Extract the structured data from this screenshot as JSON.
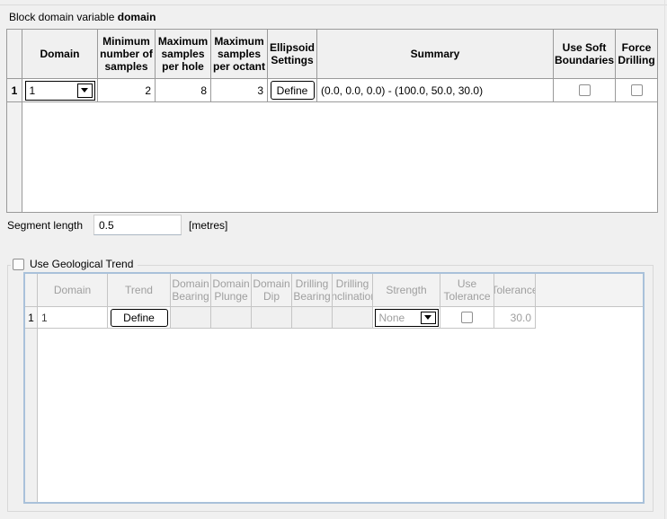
{
  "colors": {
    "panel_border": "#a9c1da",
    "grid_line_dark": "#9a9a9a",
    "grid_line_light": "#c5c5c5",
    "disabled_text": "#9e9e9e",
    "background": "#f0f0f0"
  },
  "header": {
    "title_prefix": "Block domain variable",
    "title_variable": "domain"
  },
  "domain_table": {
    "headers": {
      "domain": "Domain",
      "min_samples": "Minimum number of samples",
      "max_per_hole": "Maximum samples per hole",
      "max_per_octant": "Maximum samples per octant",
      "ellipsoid": "Ellipsoid Settings",
      "summary": "Summary",
      "use_soft": "Use Soft Boundaries",
      "force_drilling": "Force Drilling"
    },
    "row": {
      "number": "1",
      "domain": "1",
      "min_samples": "2",
      "max_per_hole": "8",
      "max_per_octant": "3",
      "define_button": "Define",
      "summary": "(0.0, 0.0, 0.0) - (100.0, 50.0, 30.0)",
      "use_soft_checked": false,
      "force_drilling_checked": false
    }
  },
  "segment": {
    "label": "Segment length",
    "value": "0.5",
    "unit": "[metres]"
  },
  "trend_section": {
    "checkbox_label": "Use Geological Trend",
    "checkbox_checked": false,
    "table": {
      "headers": {
        "domain": "Domain",
        "trend": "Trend",
        "domain_bearing": "Domain Bearing",
        "domain_plunge": "Domain Plunge",
        "domain_dip": "Domain Dip",
        "drilling_bearing": "Drilling Bearing",
        "drilling_inclination": "Drilling Inclination",
        "strength": "Strength",
        "use_tolerance": "Use Tolerance",
        "tolerance": "Tolerance"
      },
      "row": {
        "number": "1",
        "domain": "1",
        "define_button": "Define",
        "strength": "None",
        "use_tolerance_checked": false,
        "tolerance": "30.0"
      }
    }
  }
}
